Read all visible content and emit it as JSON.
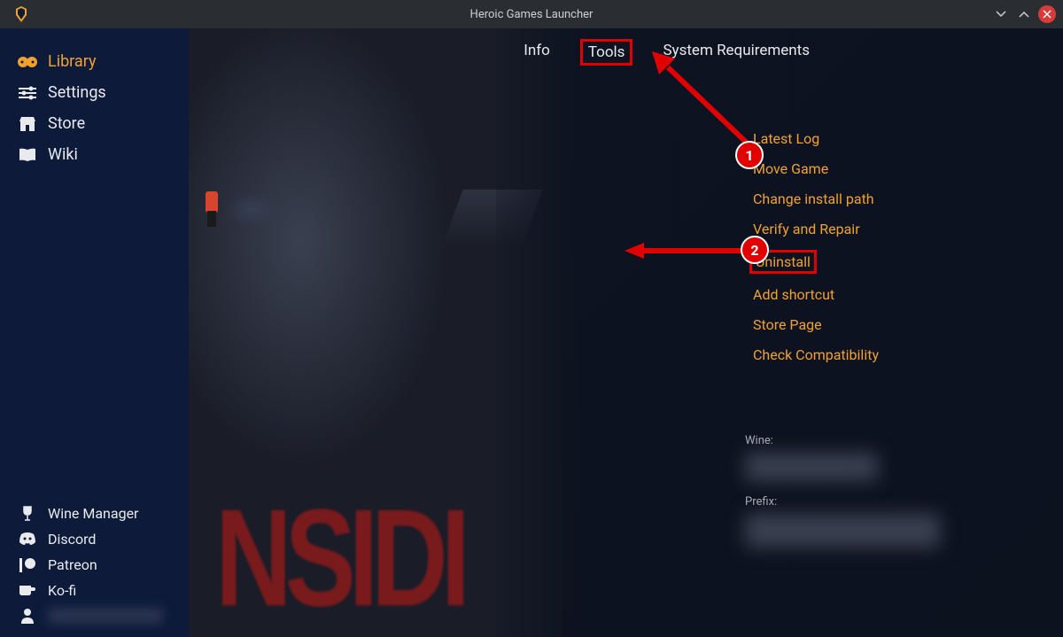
{
  "window": {
    "title": "Heroic Games Launcher"
  },
  "sidebar": {
    "top": [
      {
        "icon": "gamepad",
        "label": "Library",
        "active": true
      },
      {
        "icon": "sliders",
        "label": "Settings"
      },
      {
        "icon": "store",
        "label": "Store"
      },
      {
        "icon": "book",
        "label": "Wiki"
      }
    ],
    "bottom": [
      {
        "icon": "wine",
        "label": "Wine Manager"
      },
      {
        "icon": "discord",
        "label": "Discord"
      },
      {
        "icon": "patreon",
        "label": "Patreon"
      },
      {
        "icon": "kofi",
        "label": "Ko-fi"
      },
      {
        "icon": "user",
        "label": ""
      }
    ]
  },
  "game": {
    "title_art": "NSIDI"
  },
  "tabs": [
    {
      "label": "Info"
    },
    {
      "label": "Tools",
      "highlighted": true
    },
    {
      "label": "System Requirements"
    }
  ],
  "tools_menu": [
    {
      "label": "Latest Log"
    },
    {
      "label": "Move Game"
    },
    {
      "label": "Change install path"
    },
    {
      "label": "Verify and Repair"
    },
    {
      "label": "Uninstall",
      "highlighted": true
    },
    {
      "label": "Add shortcut"
    },
    {
      "label": "Store Page"
    },
    {
      "label": "Check Compatibility"
    }
  ],
  "info": {
    "wine_label": "Wine:",
    "prefix_label": "Prefix:"
  },
  "callouts": [
    {
      "num": "1"
    },
    {
      "num": "2"
    }
  ]
}
